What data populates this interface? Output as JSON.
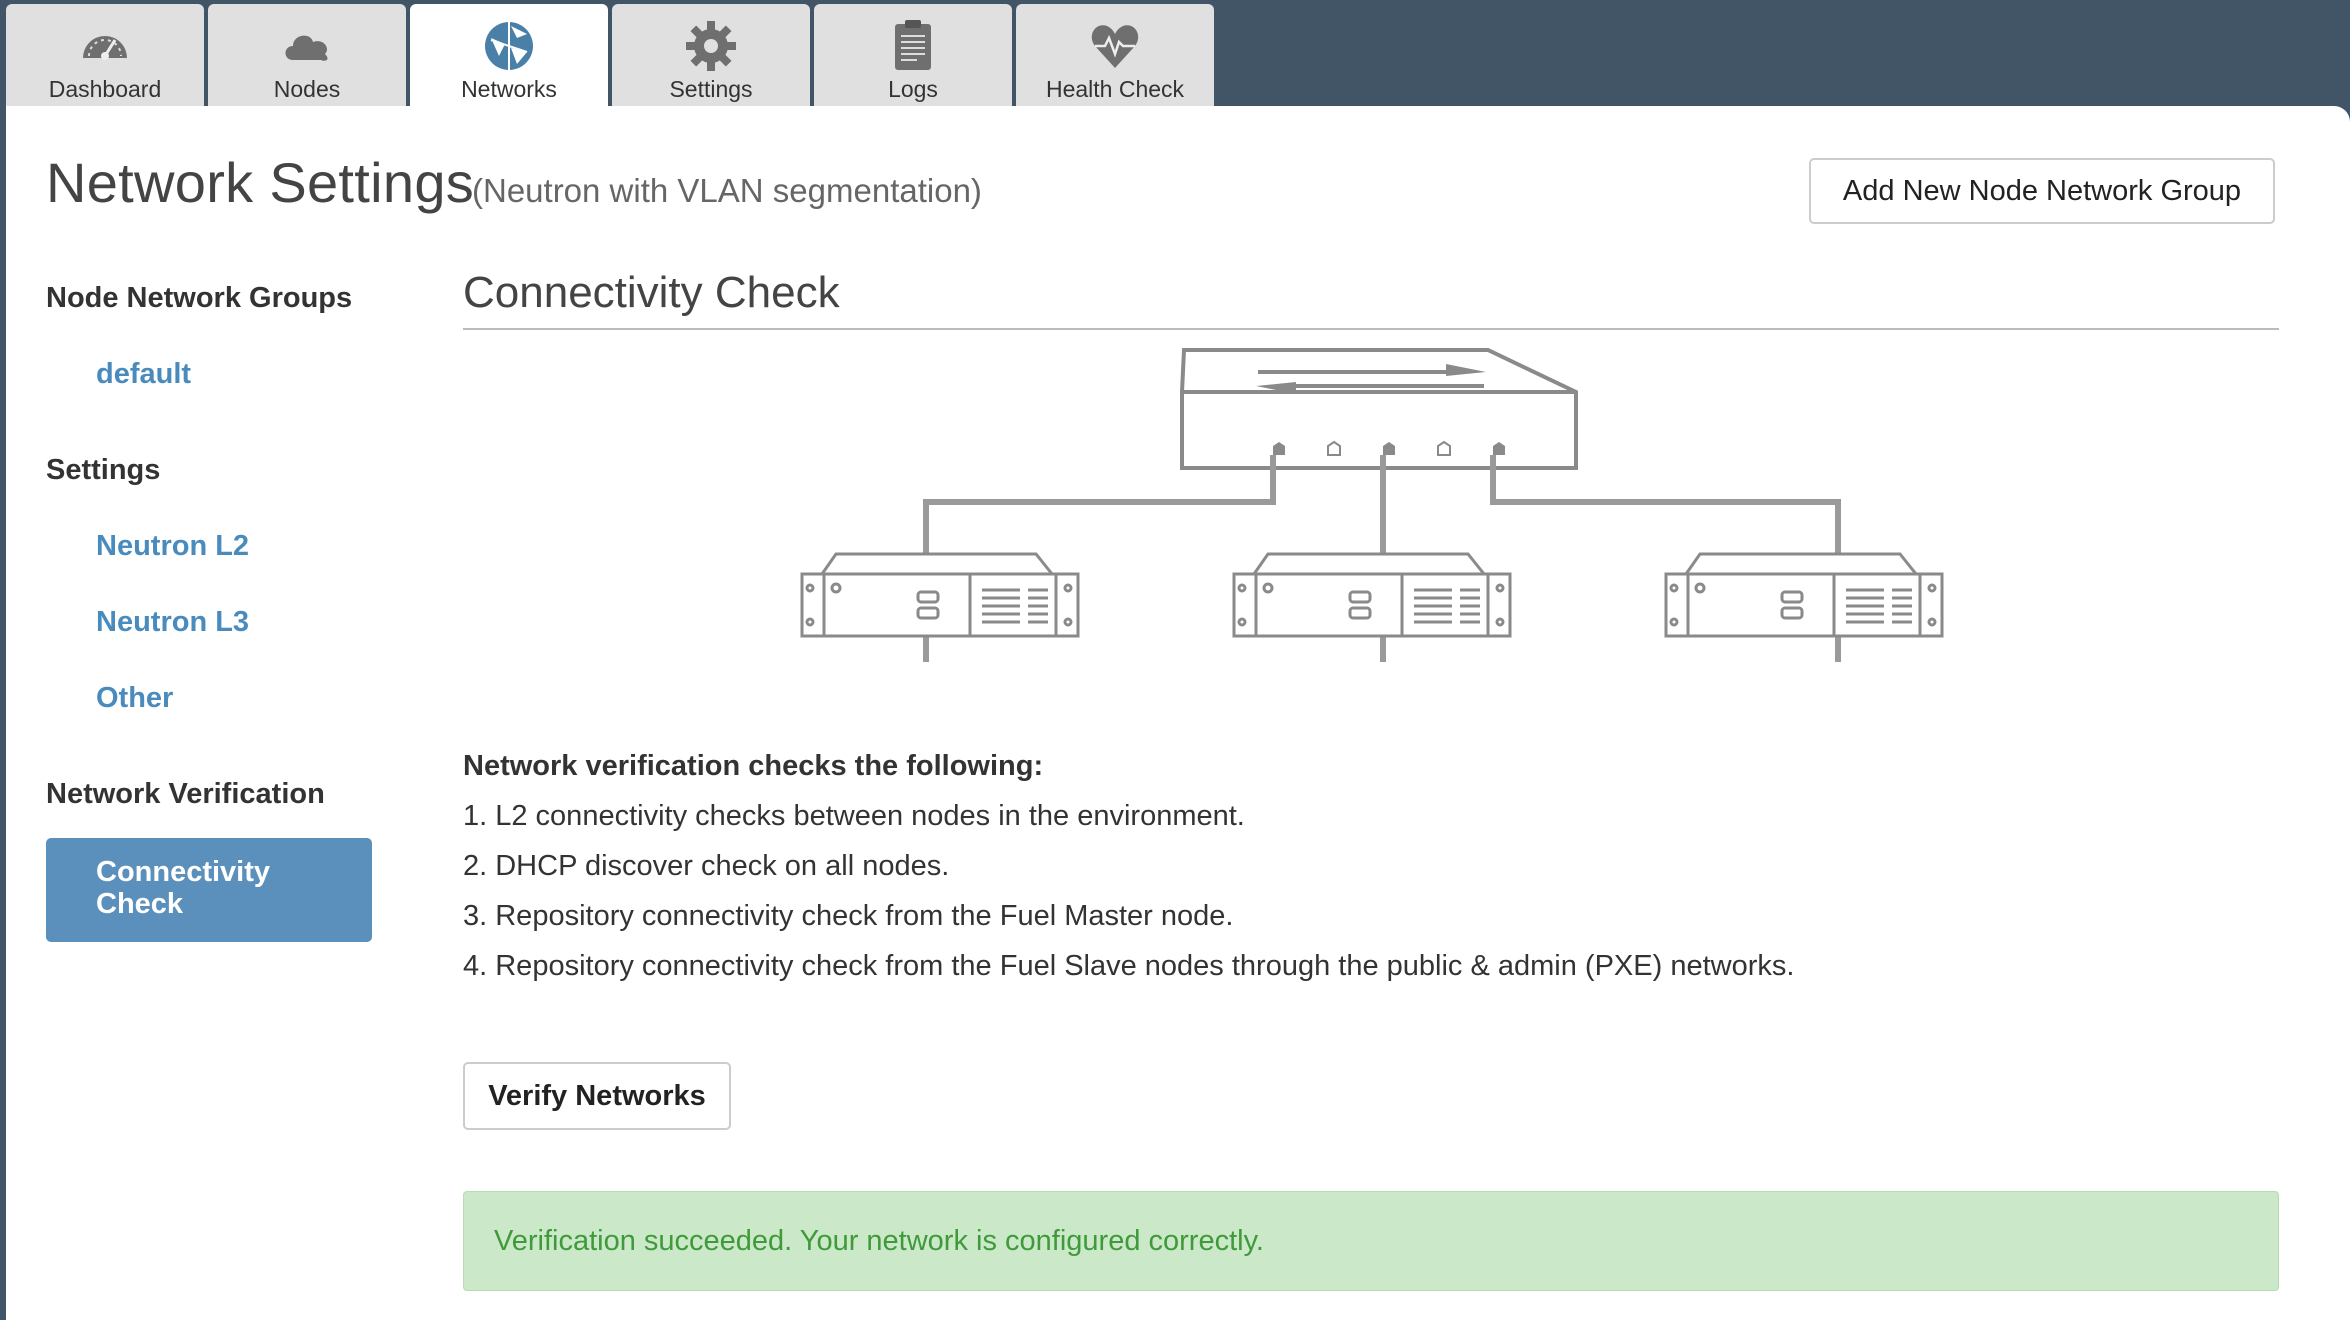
{
  "tabs": [
    {
      "label": "Dashboard",
      "icon": "dashboard-gauge-icon",
      "active": false
    },
    {
      "label": "Nodes",
      "icon": "cloud-icon",
      "active": false
    },
    {
      "label": "Networks",
      "icon": "network-globe-icon",
      "active": true
    },
    {
      "label": "Settings",
      "icon": "gear-icon",
      "active": false
    },
    {
      "label": "Logs",
      "icon": "clipboard-icon",
      "active": false
    },
    {
      "label": "Health Check",
      "icon": "heart-pulse-icon",
      "active": false
    }
  ],
  "header": {
    "title": "Network Settings",
    "subtitle": "(Neutron with VLAN segmentation)",
    "add_group_label": "Add New Node Network Group"
  },
  "sidebar": {
    "groups_heading": "Node Network Groups",
    "groups": [
      {
        "label": "default"
      }
    ],
    "settings_heading": "Settings",
    "settings": [
      {
        "label": "Neutron L2"
      },
      {
        "label": "Neutron L3"
      },
      {
        "label": "Other"
      }
    ],
    "verification_heading": "Network Verification",
    "active_item": {
      "line1": "Connectivity",
      "line2": "Check"
    }
  },
  "main": {
    "section_title": "Connectivity Check",
    "checks_heading": "Network verification checks the following:",
    "checks": [
      "1. L2 connectivity checks between nodes in the environment.",
      "2. DHCP discover check on all nodes.",
      "3. Repository connectivity check from the Fuel Master node.",
      "4. Repository connectivity check from the Fuel Slave nodes through the public & admin (PXE) networks."
    ],
    "verify_label": "Verify Networks",
    "result_message": "Verification succeeded. Your network is configured correctly."
  },
  "colors": {
    "topbar": "#415566",
    "accent": "#5a90bb",
    "link": "#4a8bbd",
    "success_bg": "#cbe8c8",
    "success_text": "#3f9a3b"
  }
}
